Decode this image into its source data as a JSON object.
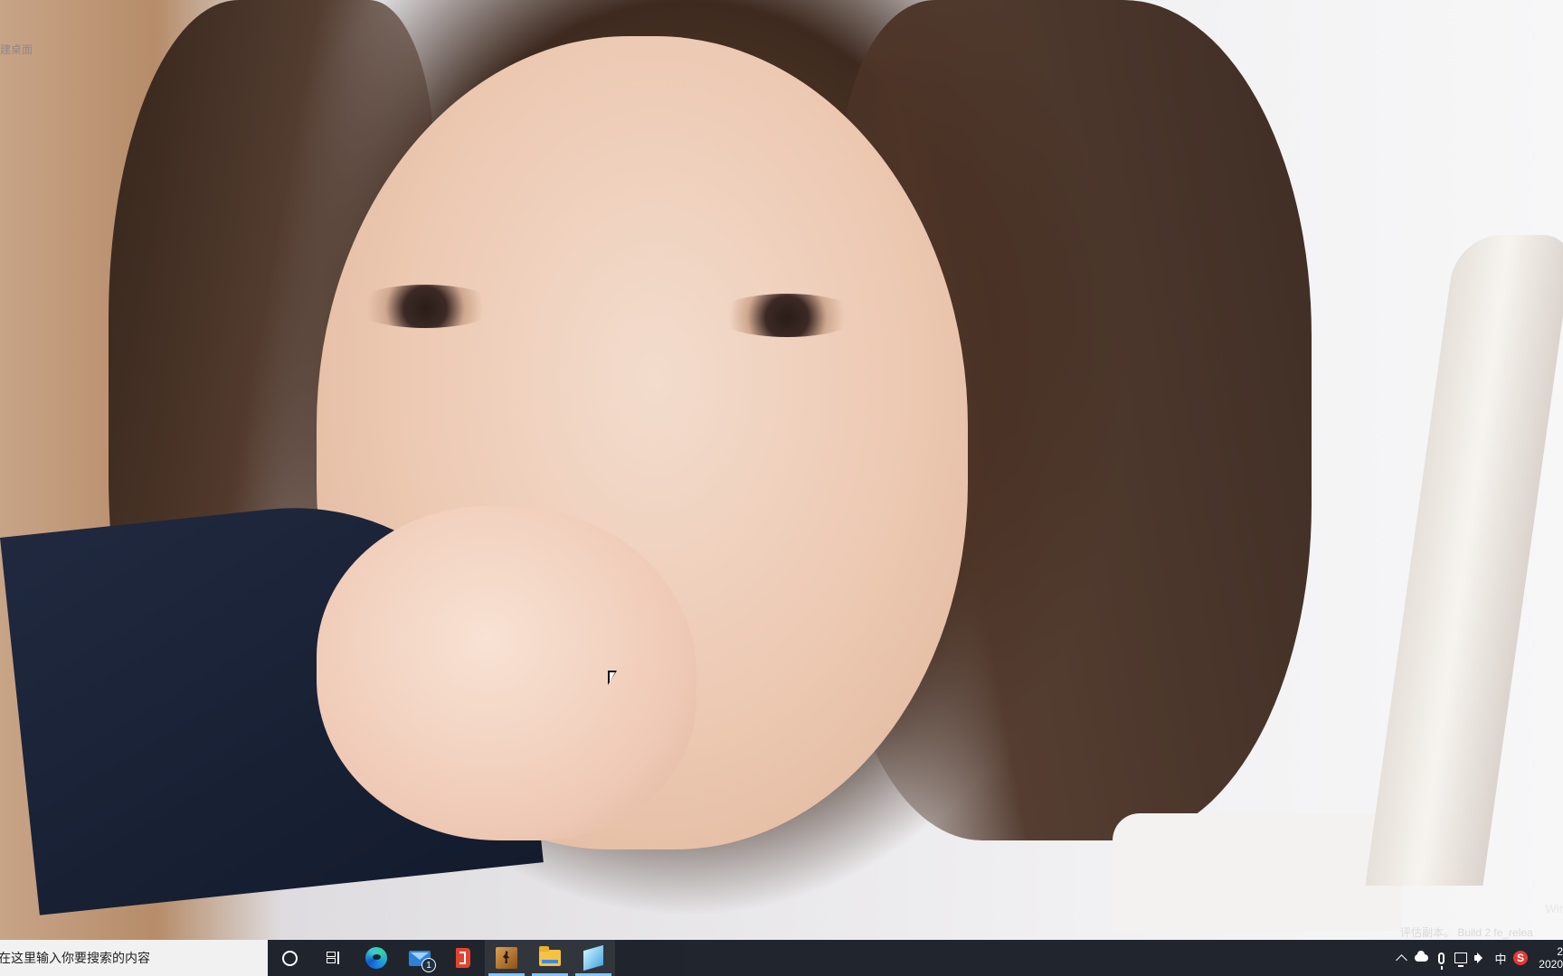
{
  "desktop": {
    "label": "建桌面",
    "watermark_line1": "Wir",
    "watermark_line2": "评估副本。 Build 2 fe_relea"
  },
  "taskbar": {
    "search_placeholder": "在这里输入你要搜索的内容",
    "icons": {
      "search_ring": "cortana-icon",
      "task_view": "task-view-icon",
      "edge": "edge-icon",
      "mail": "mail-icon",
      "office": "office-icon",
      "game": "game-icon",
      "explorer": "file-explorer-icon",
      "note": "sticky-note-icon"
    },
    "mail_badge": "1",
    "tray": {
      "ime": "中",
      "clock_line1": "2",
      "clock_line2": "2020"
    }
  },
  "colors": {
    "taskbar_bg": "#181d25",
    "accent": "#7fc4ff"
  }
}
